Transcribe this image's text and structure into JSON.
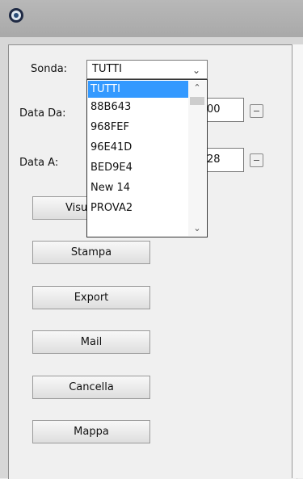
{
  "filters": {
    "sonda_label": "Sonda:",
    "sonda_selected": "TUTTI",
    "data_da_label": "Data Da:",
    "data_da_value_fragment": "00",
    "data_a_label": "Data A:",
    "data_a_value_fragment": "28"
  },
  "dropdown": {
    "options": [
      "TUTTI",
      "88B643",
      "968FEF",
      "96E41D",
      "BED9E4",
      "New 14",
      "PROVA2"
    ]
  },
  "buttons": {
    "visualizza_fragment": "Visu",
    "stampa": "Stampa",
    "export": "Export",
    "mail": "Mail",
    "cancella": "Cancella",
    "mappa": "Mappa"
  },
  "icons": {
    "app": "round-app-icon",
    "dropdown_arrow": "chevron-down-icon",
    "calendar": "calendar-icon",
    "scroll_up": "chevron-up-icon",
    "scroll_down": "chevron-down-icon"
  },
  "colors": {
    "selection": "#3399ff"
  }
}
